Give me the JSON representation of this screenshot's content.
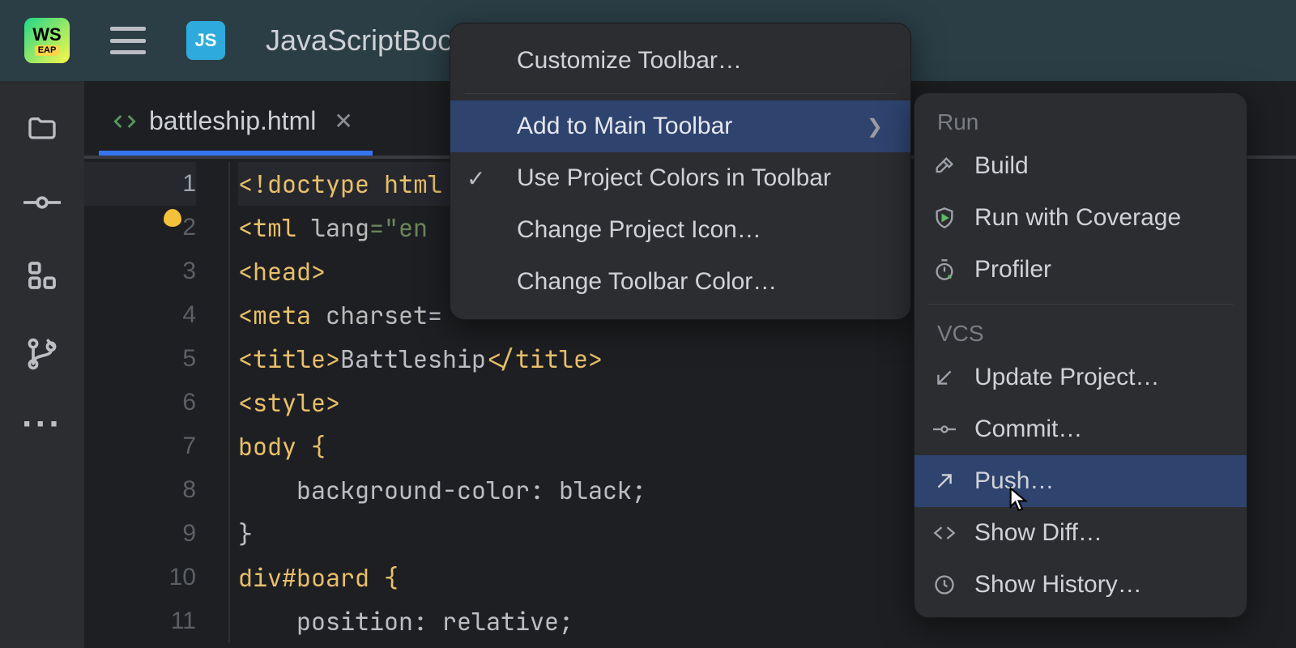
{
  "titlebar": {
    "app_abbrev": "WS",
    "app_eap": "EAP",
    "project_abbrev": "JS",
    "project_name": "JavaScriptBootc"
  },
  "tab": {
    "filename": "battleship.html"
  },
  "gutter": {
    "l1": "1",
    "l2": "2",
    "l3": "3",
    "l4": "4",
    "l5": "5",
    "l6": "6",
    "l7": "7",
    "l8": "8",
    "l9": "9",
    "l10": "10",
    "l11": "11"
  },
  "code": {
    "l1_a": "<!doctype",
    "l1_b": " html",
    "l2_a": "<",
    "l2_b": "tml ",
    "l2_c": "lang",
    "l2_d": "=\"en",
    "l3": "<head>",
    "l4_a": "<meta ",
    "l4_b": "charset",
    "l4_c": "=",
    "l5_a": "<title>",
    "l5_b": "Battleship",
    "l5_c": "</title>",
    "l6": "<style>",
    "l7": "body {",
    "l8": "    background-color: black;",
    "l9": "}",
    "l10": "div#board {",
    "l11": "    position: relative;"
  },
  "contextMenu": {
    "customize": "Customize Toolbar…",
    "addToMain": "Add to Main Toolbar",
    "useProjectColors": "Use Project Colors in Toolbar",
    "changeIcon": "Change Project Icon…",
    "changeColor": "Change Toolbar Color…"
  },
  "submenu": {
    "runHeader": "Run",
    "build": "Build",
    "runCoverage": "Run with Coverage",
    "profiler": "Profiler",
    "vcsHeader": "VCS",
    "updateProject": "Update Project…",
    "commit": "Commit…",
    "push": "Push…",
    "showDiff": "Show Diff…",
    "showHistory": "Show History…"
  }
}
